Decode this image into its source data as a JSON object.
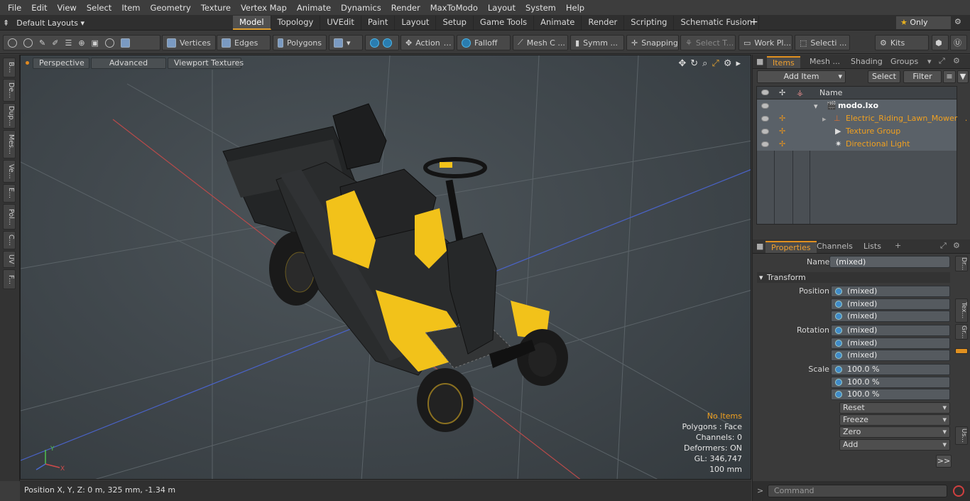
{
  "menu": [
    "File",
    "Edit",
    "View",
    "Select",
    "Item",
    "Geometry",
    "Texture",
    "Vertex Map",
    "Animate",
    "Dynamics",
    "Render",
    "MaxToModo",
    "Layout",
    "System",
    "Help"
  ],
  "layouts_label": "Default Layouts",
  "main_tabs": [
    "Model",
    "Topology",
    "UVEdit",
    "Paint",
    "Layout",
    "Setup",
    "Game Tools",
    "Animate",
    "Render",
    "Scripting",
    "Schematic Fusion"
  ],
  "active_tab": "Model",
  "only_label": "Only",
  "toolbar": {
    "vertices": "Vertices",
    "edges": "Edges",
    "polygons": "Polygons",
    "action": "Action",
    "falloff": "Falloff",
    "mesh": "Mesh C ...",
    "symm": "Symm ...",
    "snapping": "Snapping",
    "select_t": "Select T...",
    "work_pl": "Work Pl...",
    "selecti": "Selecti ...",
    "kits": "Kits"
  },
  "left_tabs": [
    "B...",
    "De...",
    "Dup...",
    "Mes...",
    "Ve...",
    "E...",
    "Pol...",
    "C...",
    "UV",
    "F..."
  ],
  "viewport": {
    "perspective": "Perspective",
    "advanced": "Advanced",
    "textures": "Viewport Textures",
    "info": {
      "no_items": "No Items",
      "polygons": "Polygons : Face",
      "channels": "Channels: 0",
      "deformers": "Deformers: ON",
      "gl": "GL: 346,747",
      "scale": "100 mm"
    }
  },
  "status": "Position X, Y, Z:   0 m, 325 mm, -1.34 m",
  "items_panel": {
    "tabs": [
      "Items",
      "Mesh ...",
      "Shading",
      "Groups"
    ],
    "add_item": "Add Item",
    "select": "Select",
    "filter": "Filter",
    "col_name": "Name",
    "rows": [
      {
        "name": "modo.lxo"
      },
      {
        "name": "Electric_Riding_Lawn_Mower ..."
      },
      {
        "name": "Texture Group"
      },
      {
        "name": "Directional Light"
      }
    ]
  },
  "properties": {
    "tabs": [
      "Properties",
      "Channels",
      "Lists"
    ],
    "name_label": "Name",
    "name_value": "(mixed)",
    "transform": "Transform",
    "rows": [
      {
        "label": "Position X",
        "value": "(mixed)"
      },
      {
        "label": "Y",
        "value": "(mixed)"
      },
      {
        "label": "Z",
        "value": "(mixed)"
      },
      {
        "label": "Rotation X",
        "value": "(mixed)"
      },
      {
        "label": "Y",
        "value": "(mixed)"
      },
      {
        "label": "Z",
        "value": "(mixed)"
      },
      {
        "label": "Scale X",
        "value": "100.0 %"
      },
      {
        "label": "Y",
        "value": "100.0 %"
      },
      {
        "label": "Z",
        "value": "100.0 %"
      }
    ],
    "actions": [
      "Reset",
      "Freeze",
      "Zero",
      "Add"
    ],
    "side_tabs": [
      "Dr...",
      "Tex...",
      "Gr...",
      "Us..."
    ]
  },
  "command_placeholder": "Command",
  "colors": {
    "accent": "#f0a020",
    "selection": "#5a6168",
    "viewport_bg": "#3f464b",
    "mower_yellow": "#f2c21a"
  }
}
